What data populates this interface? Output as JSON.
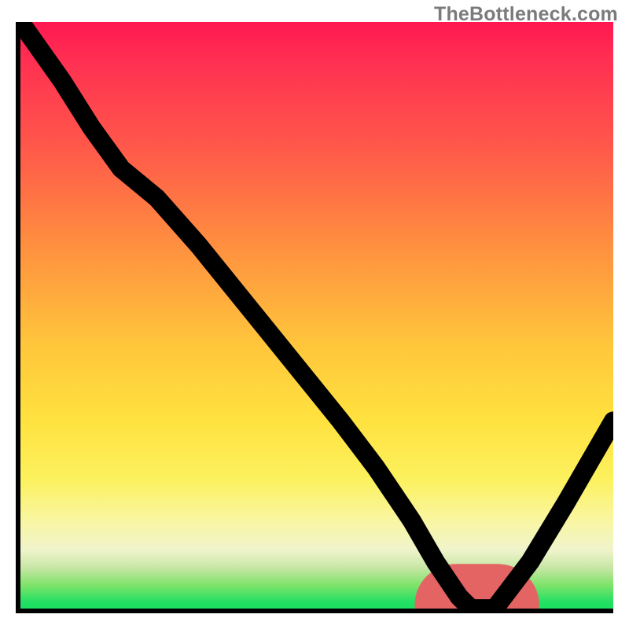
{
  "watermark": "TheBottleneck.com",
  "chart_data": {
    "type": "line",
    "title": "",
    "xlabel": "",
    "ylabel": "",
    "xlim": [
      0,
      100
    ],
    "ylim": [
      0,
      100
    ],
    "grid": false,
    "legend": null,
    "background_gradient": {
      "direction": "vertical",
      "stops": [
        {
          "pos": 0.0,
          "color": "#ff1850"
        },
        {
          "pos": 0.38,
          "color": "#ff8f3f"
        },
        {
          "pos": 0.68,
          "color": "#ffe23f"
        },
        {
          "pos": 0.85,
          "color": "#f9f6a2"
        },
        {
          "pos": 0.96,
          "color": "#7fe36a"
        },
        {
          "pos": 1.0,
          "color": "#1fe063"
        }
      ]
    },
    "series": [
      {
        "name": "curve",
        "x": [
          0,
          7,
          12,
          17,
          23,
          30,
          38,
          46,
          54,
          60,
          66,
          70,
          74,
          76,
          80,
          86,
          92,
          100
        ],
        "y": [
          100,
          90,
          82,
          75,
          70,
          62,
          52,
          42,
          32,
          24,
          15,
          8,
          2,
          0,
          0,
          8,
          18,
          32
        ]
      }
    ],
    "marker": {
      "name": "optimal-segment",
      "x_range": [
        73.5,
        80.5
      ],
      "y": 0,
      "color": "#e46464"
    }
  }
}
